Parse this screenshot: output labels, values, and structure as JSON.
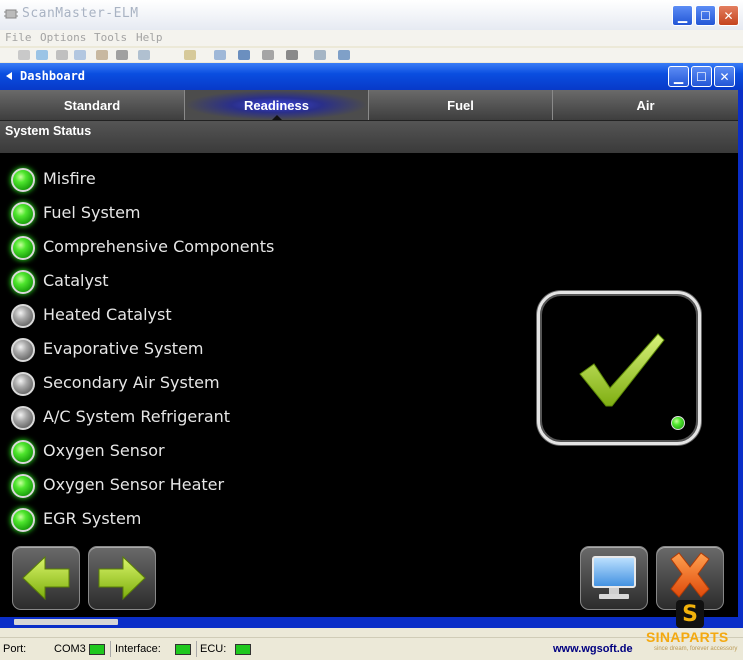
{
  "app": {
    "title": "ScanMaster-ELM",
    "menu": [
      "File",
      "Options",
      "Tools",
      "Help"
    ]
  },
  "dashboard": {
    "title": "Dashboard",
    "tabs": [
      {
        "label": "Standard",
        "active": false
      },
      {
        "label": "Readiness",
        "active": true
      },
      {
        "label": "Fuel",
        "active": false
      },
      {
        "label": "Air",
        "active": false
      }
    ],
    "section_title": "System Status",
    "status_items": [
      {
        "label": "Misfire",
        "ok": true
      },
      {
        "label": "Fuel System",
        "ok": true
      },
      {
        "label": "Comprehensive Components",
        "ok": true
      },
      {
        "label": "Catalyst",
        "ok": true
      },
      {
        "label": "Heated Catalyst",
        "ok": false
      },
      {
        "label": "Evaporative System",
        "ok": false
      },
      {
        "label": "Secondary Air System",
        "ok": false
      },
      {
        "label": "A/C System Refrigerant",
        "ok": false
      },
      {
        "label": "Oxygen Sensor",
        "ok": true
      },
      {
        "label": "Oxygen Sensor Heater",
        "ok": true
      },
      {
        "label": "EGR System",
        "ok": true
      }
    ],
    "overall_icon": "checkmark-icon",
    "buttons": [
      "back-arrow-icon",
      "forward-arrow-icon",
      "monitor-icon",
      "close-x-icon"
    ]
  },
  "statusbar": {
    "port_label": "Port:",
    "port_value": "COM3",
    "interface_label": "Interface:",
    "ecu_label": "ECU:",
    "link": "www.wgsoft.de"
  },
  "watermark": {
    "brand": "SINAPARTS",
    "tagline": "since dream, forever accessory",
    "letter": "S"
  },
  "colors": {
    "led_on": "#3ad61f",
    "led_off": "#8c8c8c",
    "check": "#9acd32",
    "close_x": "#f06a1a",
    "dash_titlebar": "#0a4ee0"
  }
}
